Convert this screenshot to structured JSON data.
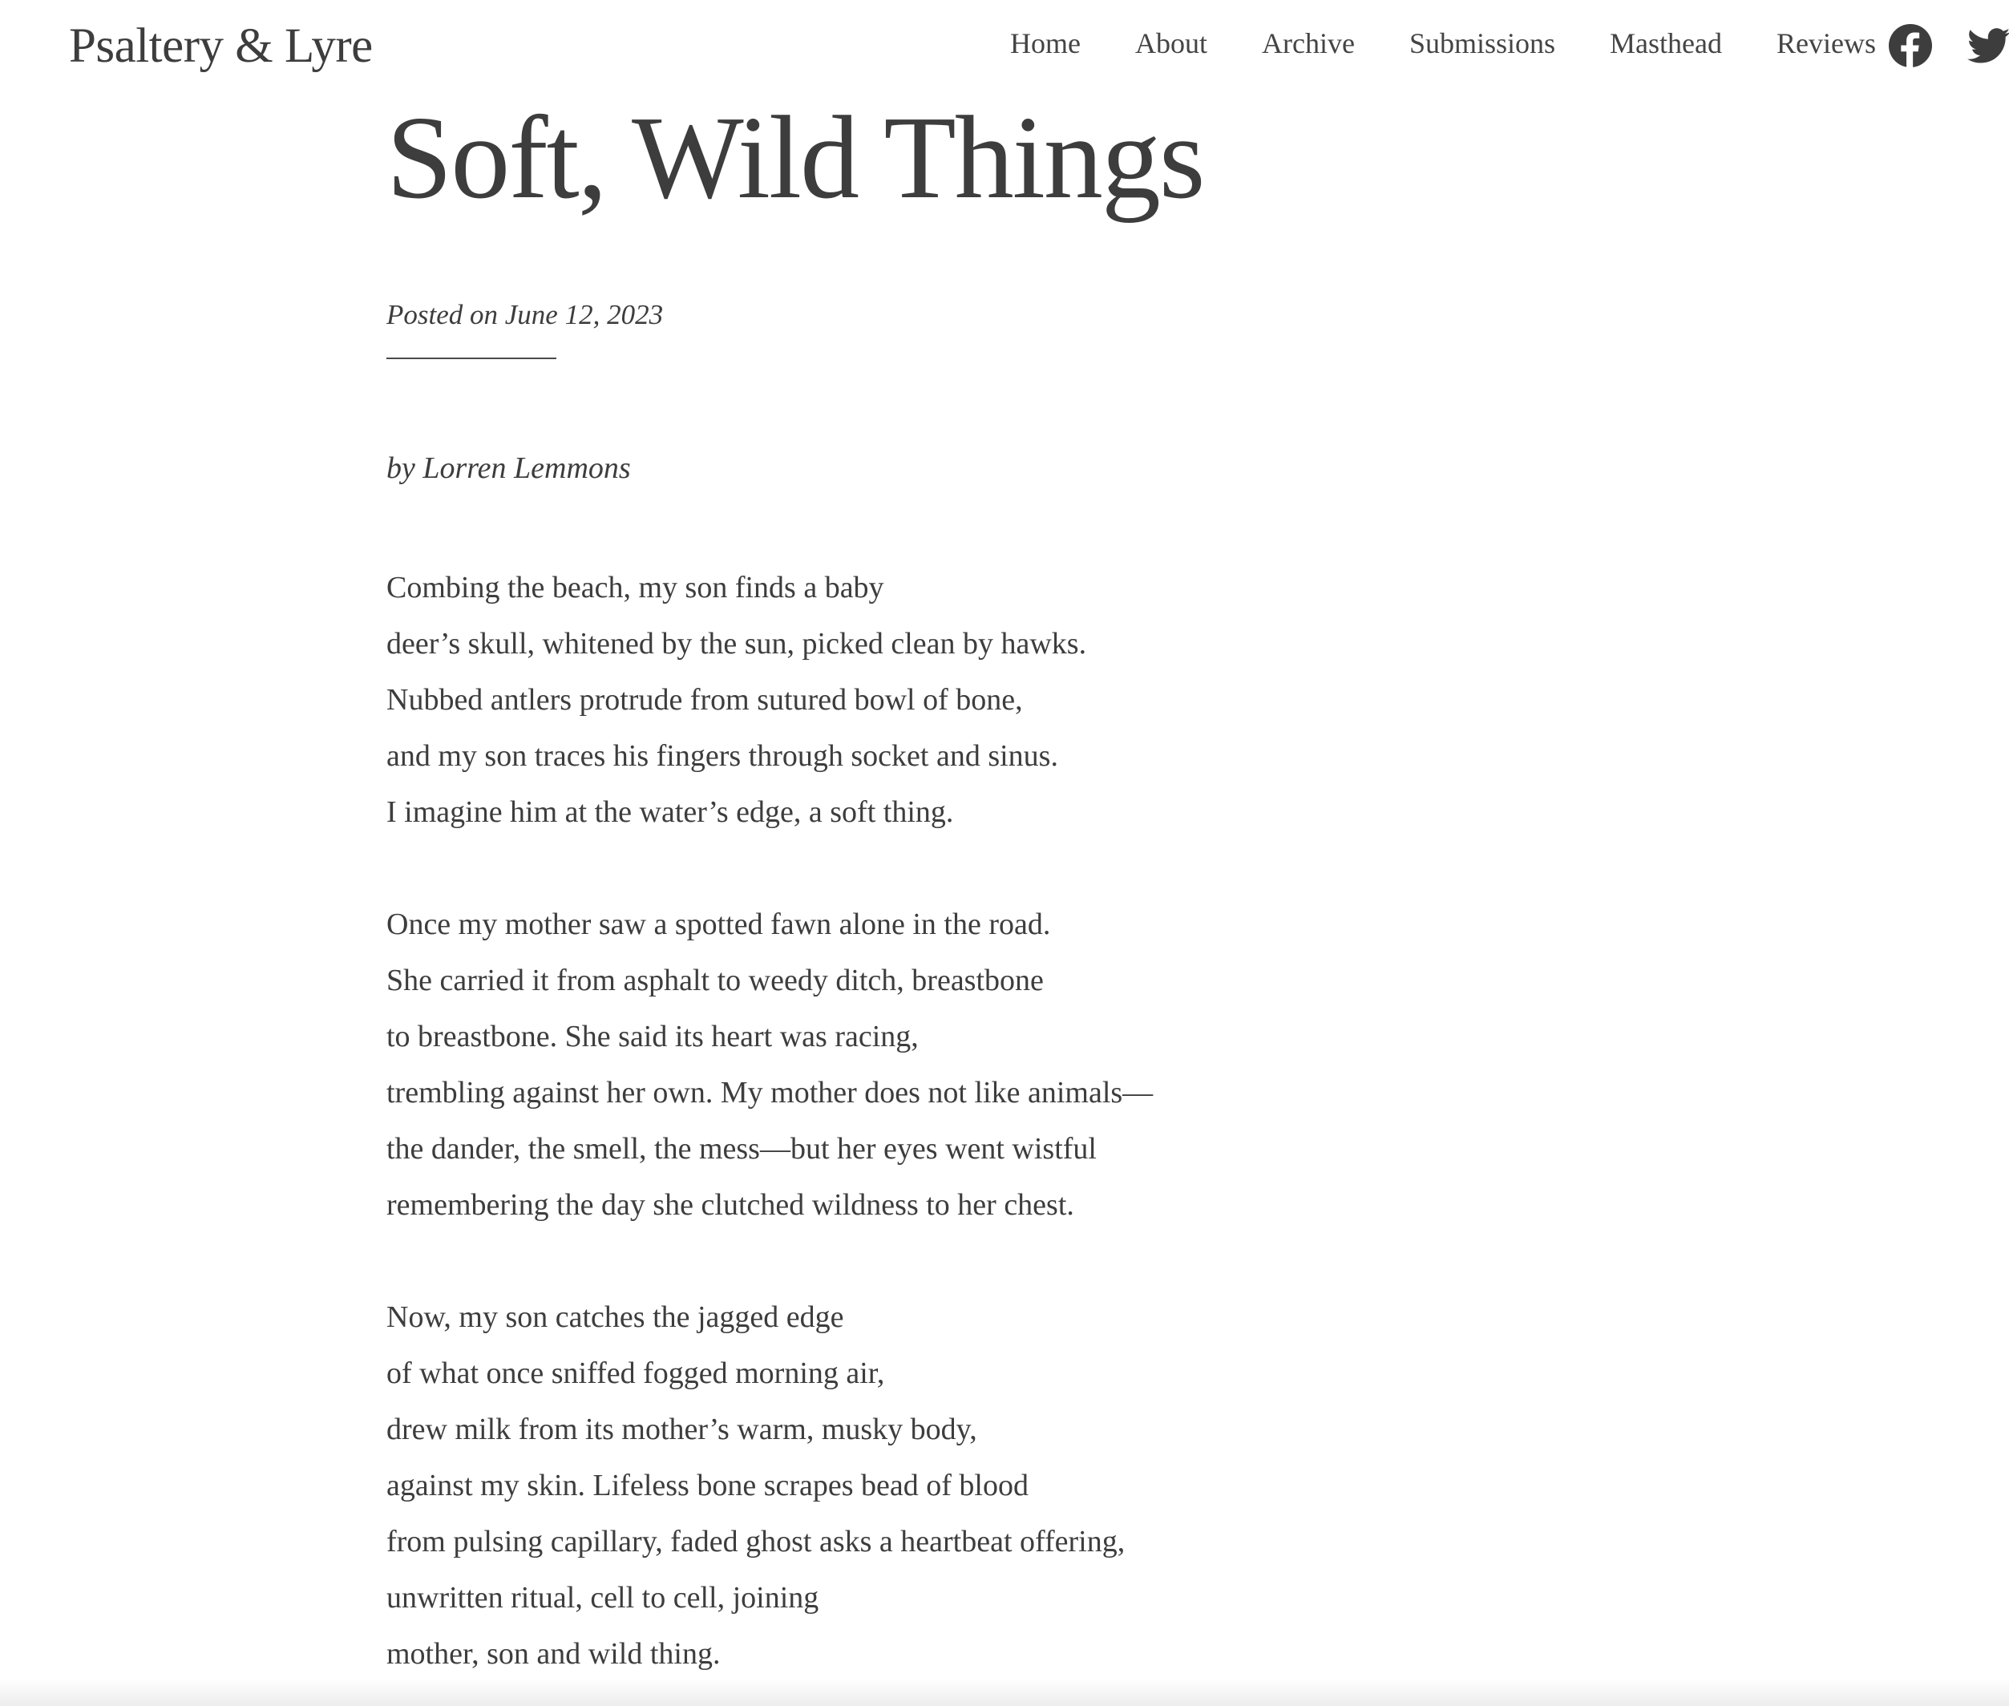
{
  "header": {
    "site_title": "Psaltery & Lyre",
    "nav": [
      {
        "label": "Home"
      },
      {
        "label": "About"
      },
      {
        "label": "Archive"
      },
      {
        "label": "Submissions"
      },
      {
        "label": "Masthead"
      },
      {
        "label": "Reviews"
      }
    ],
    "social": [
      {
        "icon": "facebook-icon"
      },
      {
        "icon": "twitter-icon"
      }
    ]
  },
  "post": {
    "title": "Soft, Wild Things",
    "meta": "Posted on June 12, 2023",
    "byline": "by Lorren Lemmons",
    "stanzas": [
      [
        "Combing the beach, my son finds a baby",
        "deer’s skull, whitened by the sun, picked clean by hawks.",
        "Nubbed antlers protrude from sutured bowl of bone,",
        "and my son traces his fingers through socket and sinus.",
        "I imagine him at the water’s edge, a soft thing."
      ],
      [
        "Once my mother saw a spotted fawn alone in the road.",
        "She carried it from asphalt to weedy ditch, breastbone",
        "to breastbone. She said its heart was racing,",
        "trembling against her own. My mother does not like animals—",
        "the dander, the smell, the mess—but her eyes went wistful",
        "remembering the day she clutched wildness to her chest."
      ],
      [
        "Now, my son catches the jagged edge",
        "of what once sniffed fogged morning air,",
        "drew milk from its mother’s warm, musky body,",
        "against my skin. Lifeless bone scrapes bead of blood",
        "from pulsing capillary, faded ghost asks a heartbeat offering,",
        "unwritten ritual, cell to cell, joining",
        "mother, son and wild thing."
      ]
    ]
  },
  "colors": {
    "text": "#3d3d3d",
    "background": "#ffffff"
  }
}
